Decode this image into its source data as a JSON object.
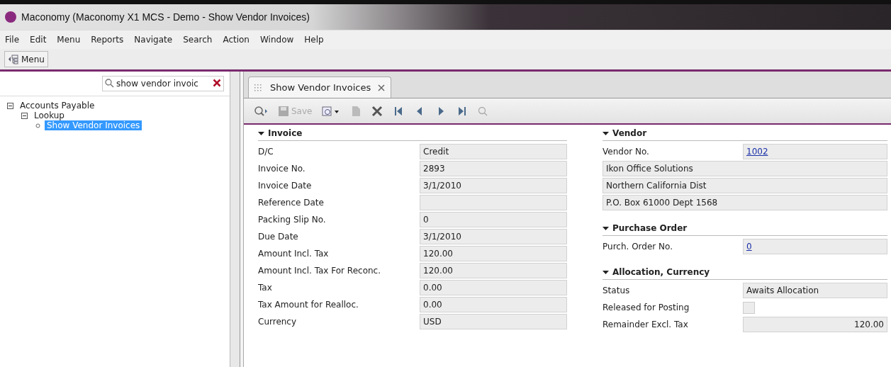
{
  "window": {
    "title": "Maconomy (Maconomy X1 MCS - Demo - Show Vendor Invoices)"
  },
  "menu_bar": [
    "File",
    "Edit",
    "Menu",
    "Reports",
    "Navigate",
    "Search",
    "Action",
    "Window",
    "Help"
  ],
  "toolbar": {
    "menu_button": "Menu"
  },
  "sidebar": {
    "search": {
      "value": "show vendor invoic"
    },
    "tree": [
      {
        "label": "Accounts Payable",
        "expanded": true,
        "selected": false,
        "children": [
          {
            "label": "Lookup",
            "expanded": true,
            "selected": false,
            "children": [
              {
                "label": "Show Vendor Invoices",
                "selected": true
              }
            ]
          }
        ]
      }
    ]
  },
  "tabs": [
    {
      "label": "Show Vendor Invoices",
      "selected": true
    }
  ],
  "actions": [
    {
      "kind": "search",
      "disabled": false
    },
    {
      "kind": "save",
      "label": "Save",
      "disabled": true
    },
    {
      "kind": "preview",
      "disabled": false
    },
    {
      "kind": "new",
      "disabled": true
    },
    {
      "kind": "delete",
      "disabled": false
    },
    {
      "kind": "first",
      "disabled": false
    },
    {
      "kind": "previous",
      "disabled": false
    },
    {
      "kind": "next",
      "disabled": false
    },
    {
      "kind": "last",
      "disabled": false
    },
    {
      "kind": "query",
      "disabled": true
    }
  ],
  "left_sections": [
    {
      "title": "Invoice",
      "fields": [
        {
          "kind": "text",
          "label": "D/C",
          "value": "Credit"
        },
        {
          "kind": "text",
          "label": "Invoice No.",
          "value": "2893"
        },
        {
          "kind": "text",
          "label": "Invoice Date",
          "value": "3/1/2010"
        },
        {
          "kind": "text",
          "label": "Reference Date"
        },
        {
          "kind": "text",
          "label": "Packing Slip No.",
          "value": "0"
        },
        {
          "kind": "text",
          "label": "Due Date",
          "value": "3/1/2010"
        },
        {
          "kind": "text",
          "label": "Amount Incl. Tax",
          "value": "120.00"
        },
        {
          "kind": "text",
          "label": "Amount Incl. Tax For Reconc.",
          "value": "120.00"
        },
        {
          "kind": "text",
          "label": "Tax",
          "value": "0.00"
        },
        {
          "kind": "text",
          "label": "Tax Amount for Realloc.",
          "value": "0.00"
        },
        {
          "kind": "text",
          "label": "Currency",
          "value": "USD"
        }
      ]
    }
  ],
  "right_sections": [
    {
      "title": "Vendor",
      "fields": [
        {
          "kind": "link",
          "label": "Vendor No.",
          "value": "1002"
        },
        {
          "kind": "address",
          "value": "Ikon Office Solutions"
        },
        {
          "kind": "address",
          "value": "Northern California Dist"
        },
        {
          "kind": "address",
          "value": "P.O. Box 61000 Dept 1568"
        }
      ]
    },
    {
      "title": "Purchase Order",
      "fields": [
        {
          "kind": "link",
          "label": "Purch. Order No.",
          "value": "0"
        }
      ]
    },
    {
      "title": "Allocation, Currency",
      "fields": [
        {
          "kind": "text",
          "label": "Status",
          "value": "Awaits Allocation"
        },
        {
          "kind": "checkbox",
          "label": "Released for Posting",
          "checked": false
        },
        {
          "kind": "amount",
          "label": "Remainder Excl. Tax",
          "value": "120.00"
        }
      ]
    }
  ]
}
